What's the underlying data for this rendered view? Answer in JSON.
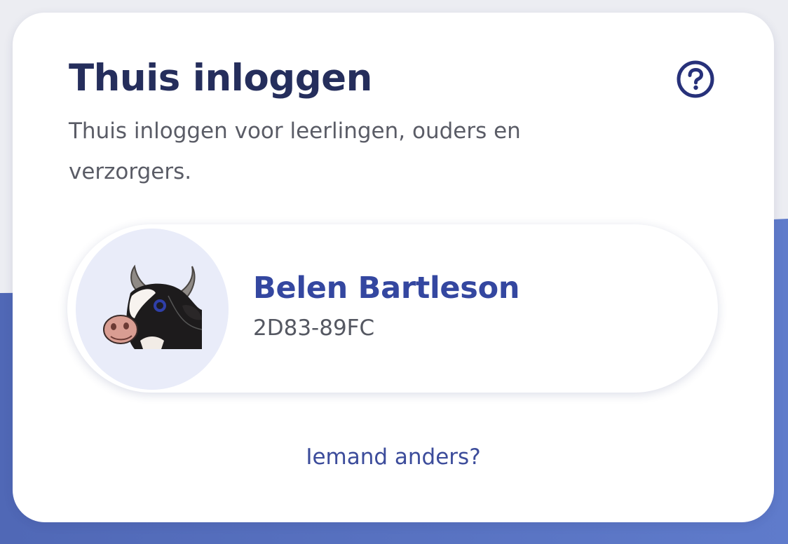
{
  "card": {
    "title": "Thuis inloggen",
    "description": "Thuis inloggen voor leerlingen, ouders en verzorgers.",
    "help_icon": "question-circle-icon"
  },
  "account": {
    "name": "Belen Bartleson",
    "code": "2D83-89FC",
    "avatar_icon": "cow-head"
  },
  "other_link": "Iemand anders?",
  "colors": {
    "title": "#252e5c",
    "accent": "#3447a0",
    "background_wave": "#5874c4",
    "avatar_bg": "#e9ecf9"
  }
}
